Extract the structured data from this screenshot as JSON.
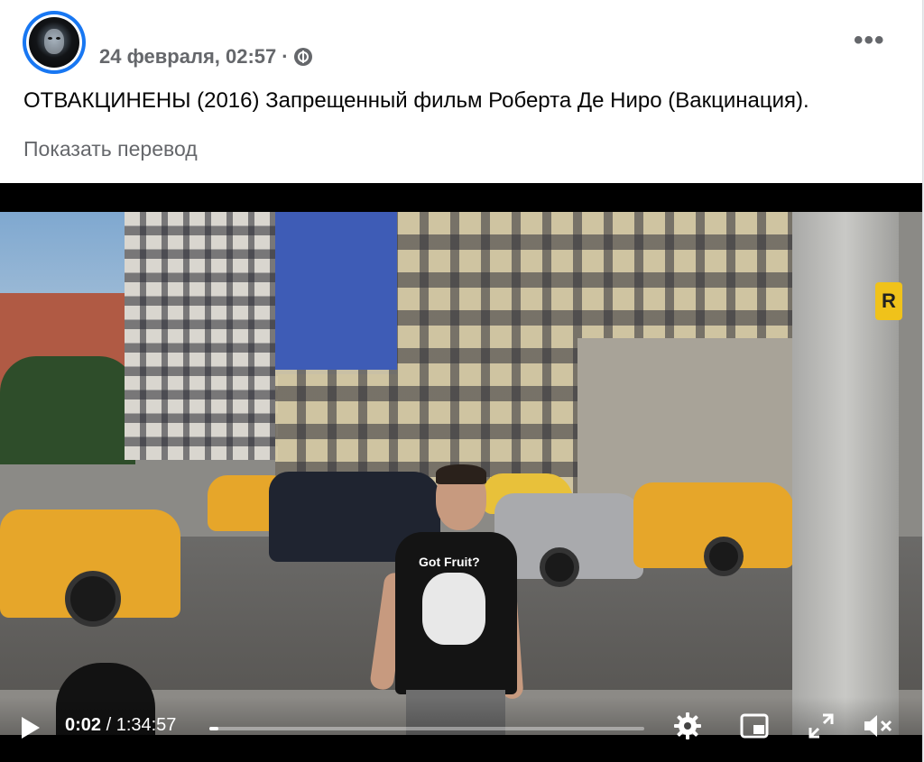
{
  "post": {
    "timestamp": "24 февраля, 02:57",
    "separator": "·",
    "audience_icon": "globe-icon",
    "more_label": "•••",
    "text": "ОТВАКЦИНЕНЫ (2016) Запрещенный фильм Роберта Де Ниро (Вакцинация).",
    "translate_label": "Показать перевод"
  },
  "video": {
    "current_time": "0:02",
    "time_separator": " / ",
    "duration": "1:34:57",
    "progress_fraction": 0.002,
    "shirt_text": "Got Fruit?",
    "sign_letter": "R",
    "icons": [
      "play-icon",
      "settings-gear-icon",
      "pip-icon",
      "fullscreen-icon",
      "mute-icon"
    ]
  },
  "colors": {
    "accent": "#1877f2",
    "secondary_text": "#65676b",
    "taxi": "#e6a62a"
  }
}
